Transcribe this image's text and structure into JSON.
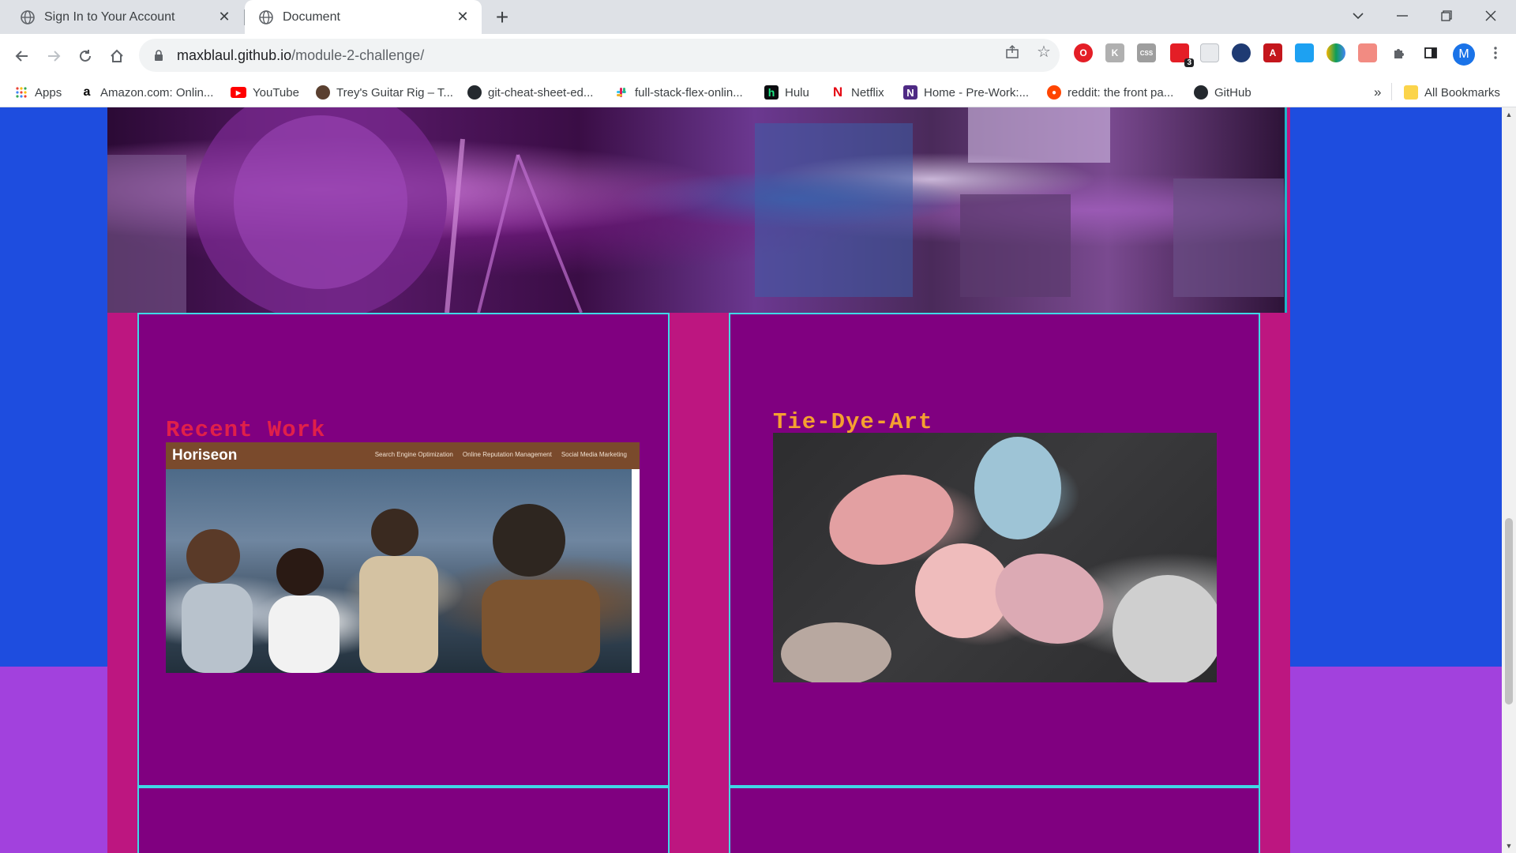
{
  "tabs": [
    {
      "label": "Sign In to Your Account",
      "icon": "globe-icon"
    },
    {
      "label": "Document",
      "icon": "globe-icon",
      "active": true
    }
  ],
  "window": {
    "dropdown": "⌄",
    "minimize": "—",
    "restore": "❐",
    "close": "✕"
  },
  "address_bar": {
    "host": "maxblaul.github.io",
    "path": "/module-2-challenge/"
  },
  "profile_initial": "M",
  "extensions": {
    "badge_count": "3"
  },
  "bookmarks": [
    {
      "label": "Apps",
      "icon": "apps-grid-icon"
    },
    {
      "label": "Amazon.com: Onlin...",
      "icon": "amazon-icon"
    },
    {
      "label": "YouTube",
      "icon": "youtube-icon"
    },
    {
      "label": "Trey's Guitar Rig – T...",
      "icon": "site-icon"
    },
    {
      "label": "git-cheat-sheet-ed...",
      "icon": "github-icon"
    },
    {
      "label": "full-stack-flex-onlin...",
      "icon": "slack-icon"
    },
    {
      "label": "Hulu",
      "icon": "hulu-icon"
    },
    {
      "label": "Netflix",
      "icon": "netflix-icon"
    },
    {
      "label": "Home - Pre-Work:...",
      "icon": "notion-icon"
    },
    {
      "label": "reddit: the front pa...",
      "icon": "reddit-icon"
    },
    {
      "label": "GitHub",
      "icon": "github-icon"
    }
  ],
  "bookmarks_overflow": "»",
  "all_bookmarks": "All Bookmarks",
  "cards": {
    "recent_work": {
      "heading": "Recent Work",
      "screenshot_brand": "Horiseon",
      "screenshot_links": [
        "Search Engine Optimization",
        "Online Reputation Management",
        "Social Media Marketing"
      ]
    },
    "tie_dye": {
      "heading": "Tie-Dye-Art"
    }
  },
  "colors": {
    "page_bg_top": "#1e4ddf",
    "page_bg_bottom": "#a241dd",
    "container": "#bd1680",
    "card": "#800080",
    "card_border": "#3fd9e6",
    "heading_red": "#e0204a",
    "heading_orange": "#f5a030"
  }
}
